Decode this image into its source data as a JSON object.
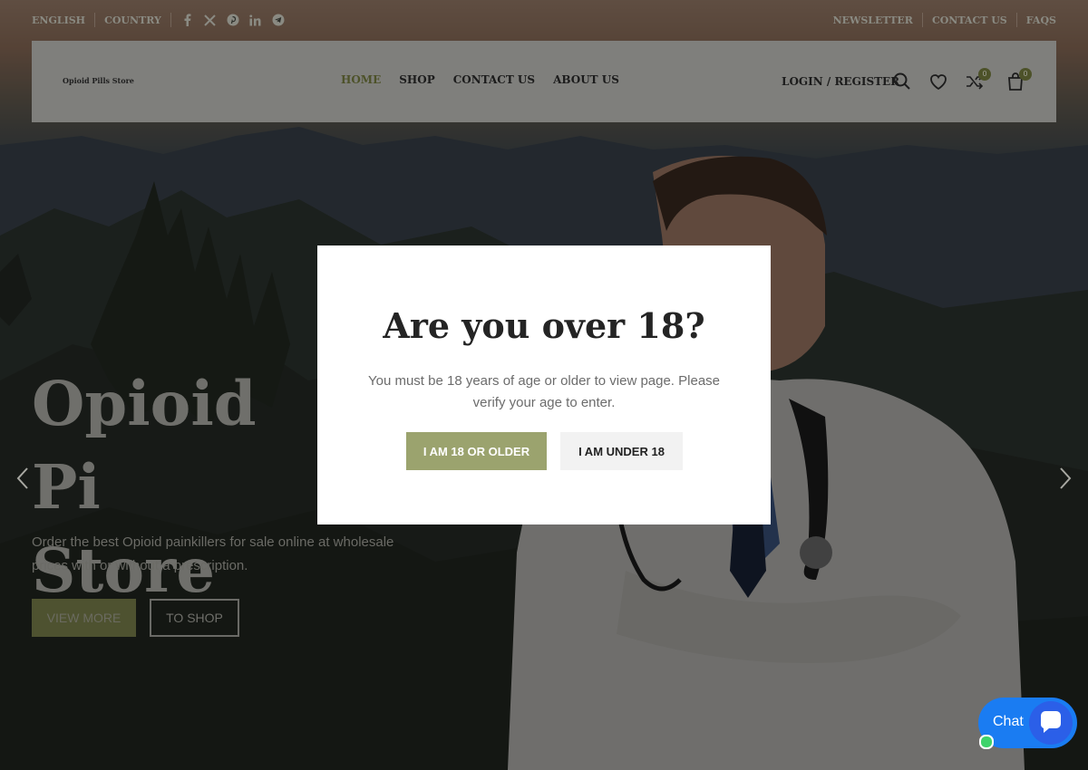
{
  "topbar": {
    "language": "ENGLISH",
    "country": "COUNTRY",
    "social_icons": [
      "facebook-icon",
      "x-icon",
      "pinterest-icon",
      "linkedin-icon",
      "telegram-icon"
    ],
    "right_links": [
      "NEWSLETTER",
      "CONTACT US",
      "FAQS"
    ]
  },
  "header": {
    "logo": "Opioid Pills Store",
    "nav": [
      "HOME",
      "SHOP",
      "CONTACT US",
      "ABOUT US"
    ],
    "active_nav": "HOME",
    "login": "LOGIN / REGISTER",
    "compare_count": "0",
    "cart_count": "0"
  },
  "hero": {
    "title_line1": "Opioid Pi",
    "title_line2": "Store",
    "desc": "Order the best Opioid painkillers for sale online at wholesale prices with or without a prescription.",
    "btn_view": "VIEW MORE",
    "btn_shop": "TO SHOP"
  },
  "modal": {
    "title": "Are you over 18?",
    "text": "You must be 18 years of age or older to view page. Please verify your age to enter.",
    "btn_yes": "I AM 18 OR OLDER",
    "btn_no": "I AM UNDER 18"
  },
  "chat": {
    "label": "Chat"
  },
  "colors": {
    "accent": "#9ba36e",
    "chat": "#1a7cf2",
    "online": "#3ed36a"
  }
}
